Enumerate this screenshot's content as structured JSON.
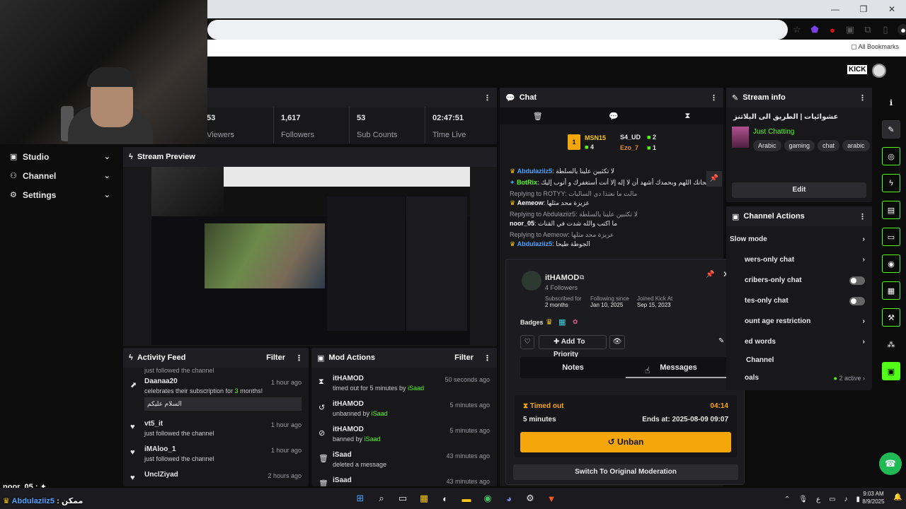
{
  "browser": {
    "bookmarks_label": "All Bookmarks"
  },
  "nav": [
    {
      "label": "Studio"
    },
    {
      "label": "Channel"
    },
    {
      "label": "Settings"
    }
  ],
  "stats": [
    {
      "value": "53",
      "label": "Viewers"
    },
    {
      "value": "1,617",
      "label": "Followers"
    },
    {
      "value": "53",
      "label": "Sub Counts"
    },
    {
      "value": "02:47:51",
      "label": "Time Live"
    }
  ],
  "stream_preview": {
    "title": "Stream Preview"
  },
  "activity_feed": {
    "title": "Activity Feed",
    "filter": "Filter",
    "top_cut": "just followed the channel",
    "items": [
      {
        "user": "Daanaa20",
        "text_pre": "celebrates their subscription for ",
        "months": "3",
        "text_post": " months!",
        "time": "1 hour ago",
        "message": "السلام عليكم"
      },
      {
        "user": "vt5_it",
        "text": "just followed the channel",
        "time": "1 hour ago"
      },
      {
        "user": "iMAloo_1",
        "text": "just followed the channel",
        "time": "1 hour ago"
      },
      {
        "user": "UnclZiyad",
        "text": "",
        "time": "2 hours ago"
      }
    ]
  },
  "mod_actions": {
    "title": "Mod Actions",
    "filter": "Filter",
    "items": [
      {
        "user": "itHAMOD",
        "text": "timed out for 5 minutes by",
        "by": "iSaad",
        "time": "50 seconds ago"
      },
      {
        "user": "itHAMOD",
        "text": "unbanned by",
        "by": "iSaad",
        "time": "5 minutes ago"
      },
      {
        "user": "itHAMOD",
        "text": "banned by",
        "by": "iSaad",
        "time": "5 minutes ago"
      },
      {
        "user": "iSaad",
        "text": "deleted a message",
        "by": "",
        "time": "43 minutes ago"
      },
      {
        "user": "iSaad",
        "text": "",
        "by": "",
        "time": "43 minutes ago"
      }
    ]
  },
  "chat": {
    "title": "Chat",
    "leaderboard": {
      "first": "MSN15",
      "first_count": "4",
      "second": "S4_UD",
      "second_count": "2",
      "third": "Ezo_7",
      "third_count": "1"
    },
    "lines": [
      {
        "user": "Abdulaziiz5",
        "msg": "لا تكثبين علينا يالسلطة"
      },
      {
        "user": "BotRix",
        "msg": "سبحانك اللهم وبحمدك أشهد أن لا إله إلا أنت أستغفرك و أتوب إليك"
      },
      {
        "reply": "Replying to ROTYY: مالت ما نعتذا دي السالبات"
      },
      {
        "user": "Aemeow",
        "msg": "عزيزة محد مثلها"
      },
      {
        "reply": "Replying to Abdulaziiz5: لا تكثبين علينا يالسلطة"
      },
      {
        "user": "noor_05",
        "msg": "ما اكتب والله شدت في القنات"
      },
      {
        "reply": "Replying to Aemeow: عزيزة محد مثلها"
      },
      {
        "user": "Abdulaziiz5",
        "msg": "الجوطة طيحا"
      }
    ]
  },
  "user_card": {
    "username": "itHAMOD",
    "followers": "4 Followers",
    "subscribed_for_label": "Subscribed for",
    "subscribed_for": "2 months",
    "following_since_label": "Following since",
    "following_since": "Jan 10, 2025",
    "joined_label": "Joined Kick At",
    "joined": "Sep 15, 2023",
    "badges_label": "Badges",
    "add_priority": "Add To Priority",
    "tab_notes": "Notes",
    "tab_messages": "Messages",
    "timed_out": "Timed out",
    "countdown": "04:14",
    "duration": "5 minutes",
    "ends_at": "Ends at: 2025-08-09 09:07",
    "unban": "Unban",
    "switch": "Switch To Original Moderation"
  },
  "stream_info": {
    "title": "Stream info",
    "stream_title": "عشوائيات | الطريق الى البلاتنز",
    "category": "Just Chatting",
    "tags": [
      "Arabic",
      "gaming",
      "chat",
      "arabic"
    ],
    "edit": "Edit"
  },
  "channel_actions": {
    "title": "Channel Actions",
    "items": [
      {
        "label": "Slow mode"
      },
      {
        "label": "wers-only chat"
      },
      {
        "label": "cribers-only chat"
      },
      {
        "label": "tes-only chat"
      },
      {
        "label": "ount age restriction"
      },
      {
        "label": "ed words"
      },
      {
        "label": "Channel"
      },
      {
        "label": "oals",
        "extra": "2 active"
      }
    ]
  },
  "overlay_bottom": {
    "line1_user": "noor_05",
    "line2_user": "Abdulaziiz5",
    "line2_msg": "ممكن"
  },
  "taskbar": {
    "lang": "ع",
    "time": "9:03 AM",
    "date": "8/9/2025"
  },
  "colors": {
    "accent": "#53fc18",
    "unban": "#f5a60b",
    "username_blue": "#4aa3ff"
  }
}
